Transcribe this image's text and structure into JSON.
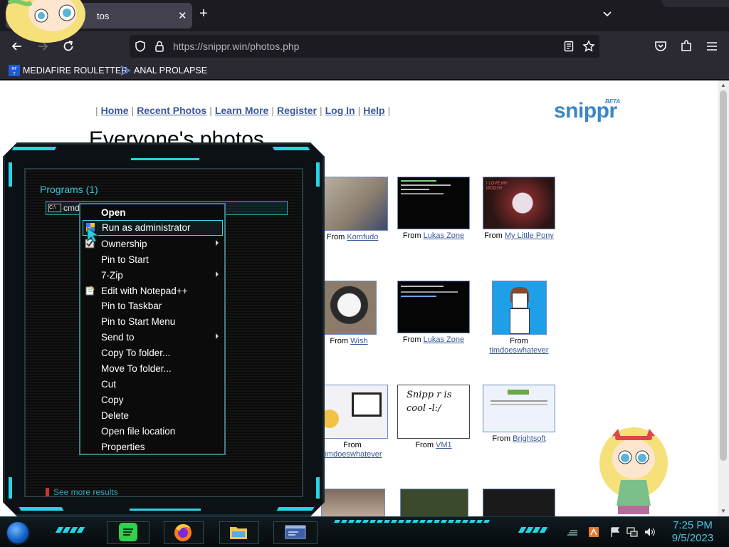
{
  "browser": {
    "tab_title": "tos",
    "close_glyph": "✕",
    "new_tab_glyph": "+",
    "url_domain": "https://snippr.win",
    "url_path": "/photos.php",
    "bookmarks": [
      {
        "label": "MEDIAFIRE ROULETTER",
        "icon": "mediafire-icon"
      },
      {
        "label": "ANAL PROLAPSE",
        "icon": "bookmark-icon"
      }
    ]
  },
  "site": {
    "logo": "snippr",
    "logo_beta": "BETA",
    "nav": [
      "Home",
      "Recent Photos",
      "Learn More",
      "Register",
      "Log In",
      "Help"
    ],
    "nav_sep": "|",
    "title": "Everyone's photos",
    "from_label": "From",
    "photos": [
      {
        "source": "Komfudo"
      },
      {
        "source": "Lukas Zone"
      },
      {
        "source": "My Little Pony"
      },
      {
        "source": "Wish"
      },
      {
        "source": "Lukas Zone"
      },
      {
        "source": "timdoeswhatever"
      },
      {
        "source": "timdoeswhatever"
      },
      {
        "source": "VM1"
      },
      {
        "source": "Brightsoft"
      }
    ],
    "thumb_text": {
      "pony": "I LOVE MY iPOD!!!!!",
      "snippr_note": "Snipp r is cool -l:/"
    }
  },
  "start_menu": {
    "section": "Programs (1)",
    "result_label": "cmd",
    "result_icon_text": "C:\\",
    "see_more": "See more results"
  },
  "context_menu": {
    "items": [
      {
        "label": "Open",
        "bold": true
      },
      {
        "label": "Run as administrator",
        "highlighted": true,
        "icon": "shield-icon"
      },
      {
        "label": "Ownership",
        "submenu": true,
        "icon": "checkbox-icon"
      },
      {
        "label": "Pin to Start"
      },
      {
        "label": "7-Zip",
        "submenu": true
      },
      {
        "label": "Edit with Notepad++",
        "icon": "notepad-icon"
      },
      {
        "label": "Pin to Taskbar"
      },
      {
        "label": "Pin to Start Menu"
      },
      {
        "label": "Send to",
        "submenu": true
      },
      {
        "label": "Copy To folder..."
      },
      {
        "label": "Move To folder..."
      },
      {
        "label": "Cut"
      },
      {
        "label": "Copy"
      },
      {
        "label": "Delete"
      },
      {
        "label": "Open file location"
      },
      {
        "label": "Properties"
      }
    ]
  },
  "taskbar": {
    "apps": [
      "spotify-icon",
      "firefox-icon",
      "file-explorer-icon",
      "window-icon"
    ],
    "time": "7:25 PM",
    "date": "9/5/2023"
  },
  "colors": {
    "accent_cyan": "#29d3e6",
    "link_blue": "#3b5998",
    "logo_blue": "#3a86c8"
  }
}
